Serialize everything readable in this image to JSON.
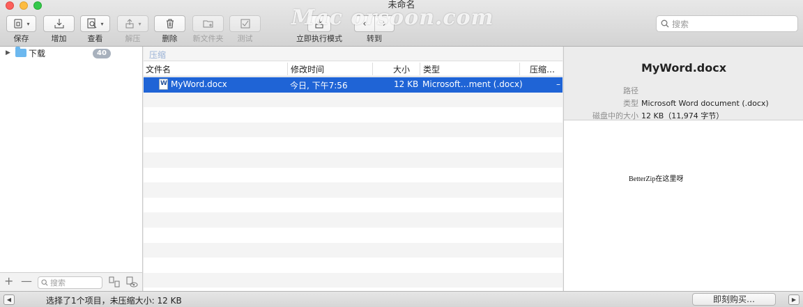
{
  "window": {
    "title": "未命名",
    "watermark": "Mac orsoon.com"
  },
  "toolbar": {
    "save_label": "保存",
    "add_label": "增加",
    "view_label": "查看",
    "extract_label": "解压",
    "delete_label": "删除",
    "new_folder_label": "新文件夹",
    "test_label": "测试",
    "execute_mode_label": "立即执行模式",
    "goto_label": "转到",
    "search_placeholder": "搜索"
  },
  "sidebar": {
    "items": [
      {
        "label": "下载",
        "count": "40"
      }
    ],
    "search_placeholder": "搜索",
    "add_symbol": "+",
    "remove_symbol": "—"
  },
  "file_list": {
    "path_label": "压缩",
    "columns": [
      "文件名",
      "修改时间",
      "大小",
      "类型",
      "压缩…"
    ],
    "rows": [
      {
        "name": "MyWord.docx",
        "modified": "今日, 下午7:56",
        "size": "12 KB",
        "type": "Microsoft…ment (.docx)",
        "compressed": "–"
      }
    ],
    "empty_rows": 13
  },
  "info": {
    "title": "MyWord.docx",
    "path_key": "路径",
    "path_value": "",
    "type_key": "类型",
    "type_value": "Microsoft Word document (.docx)",
    "disk_size_key": "磁盘中的大小",
    "disk_size_value": "12 KB（11,974 字节）",
    "preview_text": "BetterZip在这里呀"
  },
  "status": {
    "text": "选择了1个项目，未压缩大小: 12 KB",
    "buy_label": "即刻购买…"
  },
  "colors": {
    "selection": "#1f64d6",
    "badge": "#a8b1bd",
    "path_text": "#9cb3d6"
  }
}
